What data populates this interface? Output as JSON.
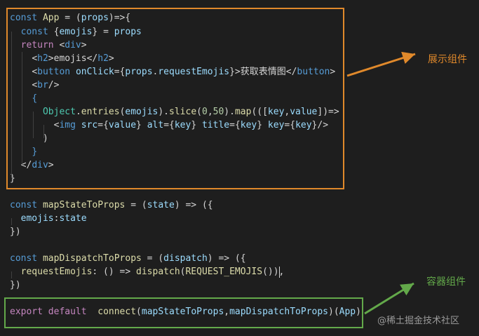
{
  "editor": {
    "lines": [
      [
        {
          "t": "const ",
          "c": "k1"
        },
        {
          "t": "App",
          "c": "fn"
        },
        {
          "t": " = (",
          "c": "punc"
        },
        {
          "t": "props",
          "c": "var"
        },
        {
          "t": ")=>{",
          "c": "punc"
        }
      ],
      [
        {
          "t": "  ",
          "c": "punc"
        },
        {
          "t": "const ",
          "c": "k1"
        },
        {
          "t": "{",
          "c": "punc"
        },
        {
          "t": "emojis",
          "c": "var"
        },
        {
          "t": "} = ",
          "c": "punc"
        },
        {
          "t": "props",
          "c": "var"
        }
      ],
      [
        {
          "t": "  ",
          "c": "punc"
        },
        {
          "t": "return ",
          "c": "k2"
        },
        {
          "t": "<",
          "c": "punc"
        },
        {
          "t": "div",
          "c": "tag"
        },
        {
          "t": ">",
          "c": "punc"
        }
      ],
      [
        {
          "t": "    ",
          "c": "punc"
        },
        {
          "t": "<",
          "c": "punc"
        },
        {
          "t": "h2",
          "c": "tag"
        },
        {
          "t": ">emojis</",
          "c": "punc"
        },
        {
          "t": "h2",
          "c": "tag"
        },
        {
          "t": ">",
          "c": "punc"
        }
      ],
      [
        {
          "t": "    ",
          "c": "punc"
        },
        {
          "t": "<",
          "c": "punc"
        },
        {
          "t": "button ",
          "c": "tag"
        },
        {
          "t": "onClick",
          "c": "attr"
        },
        {
          "t": "={",
          "c": "punc"
        },
        {
          "t": "props",
          "c": "var"
        },
        {
          "t": ".",
          "c": "punc"
        },
        {
          "t": "requestEmojis",
          "c": "var"
        },
        {
          "t": "}>获取表情图</",
          "c": "punc"
        },
        {
          "t": "button",
          "c": "tag"
        },
        {
          "t": ">",
          "c": "punc"
        }
      ],
      [
        {
          "t": "    ",
          "c": "punc"
        },
        {
          "t": "<",
          "c": "punc"
        },
        {
          "t": "br",
          "c": "tag"
        },
        {
          "t": "/>",
          "c": "punc"
        }
      ],
      [
        {
          "t": "    ",
          "c": "punc"
        },
        {
          "t": "{",
          "c": "k1"
        }
      ],
      [
        {
          "t": "      ",
          "c": "punc"
        },
        {
          "t": "Object",
          "c": "cls"
        },
        {
          "t": ".",
          "c": "punc"
        },
        {
          "t": "entries",
          "c": "fn"
        },
        {
          "t": "(",
          "c": "punc"
        },
        {
          "t": "emojis",
          "c": "var"
        },
        {
          "t": ").",
          "c": "punc"
        },
        {
          "t": "slice",
          "c": "fn"
        },
        {
          "t": "(",
          "c": "punc"
        },
        {
          "t": "0",
          "c": "num"
        },
        {
          "t": ",",
          "c": "punc"
        },
        {
          "t": "50",
          "c": "num"
        },
        {
          "t": ").",
          "c": "punc"
        },
        {
          "t": "map",
          "c": "fn"
        },
        {
          "t": "(([",
          "c": "punc"
        },
        {
          "t": "key",
          "c": "var"
        },
        {
          "t": ",",
          "c": "punc"
        },
        {
          "t": "value",
          "c": "var"
        },
        {
          "t": "])=>",
          "c": "punc"
        }
      ],
      [
        {
          "t": "        ",
          "c": "punc"
        },
        {
          "t": "<",
          "c": "punc"
        },
        {
          "t": "img ",
          "c": "tag"
        },
        {
          "t": "src",
          "c": "attr"
        },
        {
          "t": "={",
          "c": "punc"
        },
        {
          "t": "value",
          "c": "var"
        },
        {
          "t": "} ",
          "c": "punc"
        },
        {
          "t": "alt",
          "c": "attr"
        },
        {
          "t": "={",
          "c": "punc"
        },
        {
          "t": "key",
          "c": "var"
        },
        {
          "t": "} ",
          "c": "punc"
        },
        {
          "t": "title",
          "c": "attr"
        },
        {
          "t": "={",
          "c": "punc"
        },
        {
          "t": "key",
          "c": "var"
        },
        {
          "t": "} ",
          "c": "punc"
        },
        {
          "t": "key",
          "c": "attr"
        },
        {
          "t": "={",
          "c": "punc"
        },
        {
          "t": "key",
          "c": "var"
        },
        {
          "t": "}/>",
          "c": "punc"
        }
      ],
      [
        {
          "t": "      )",
          "c": "punc"
        }
      ],
      [
        {
          "t": "    ",
          "c": "punc"
        },
        {
          "t": "}",
          "c": "k1"
        }
      ],
      [
        {
          "t": "  </",
          "c": "punc"
        },
        {
          "t": "div",
          "c": "tag"
        },
        {
          "t": ">",
          "c": "punc"
        }
      ],
      [
        {
          "t": "}",
          "c": "punc"
        }
      ],
      [
        {
          "t": "",
          "c": "punc"
        }
      ],
      [
        {
          "t": "const ",
          "c": "k1"
        },
        {
          "t": "mapStateToProps",
          "c": "fn"
        },
        {
          "t": " = (",
          "c": "punc"
        },
        {
          "t": "state",
          "c": "var"
        },
        {
          "t": ") => ({",
          "c": "punc"
        }
      ],
      [
        {
          "t": "  ",
          "c": "punc"
        },
        {
          "t": "emojis",
          "c": "var"
        },
        {
          "t": ":",
          "c": "punc"
        },
        {
          "t": "state",
          "c": "var"
        }
      ],
      [
        {
          "t": "})",
          "c": "punc"
        }
      ],
      [
        {
          "t": "",
          "c": "punc"
        }
      ],
      [
        {
          "t": "const ",
          "c": "k1"
        },
        {
          "t": "mapDispatchToProps",
          "c": "fn"
        },
        {
          "t": " = (",
          "c": "punc"
        },
        {
          "t": "dispatch",
          "c": "var"
        },
        {
          "t": ") => ({",
          "c": "punc"
        }
      ],
      [
        {
          "t": "  ",
          "c": "punc"
        },
        {
          "t": "requestEmojis",
          "c": "fn"
        },
        {
          "t": ": () => ",
          "c": "punc"
        },
        {
          "t": "dispatch",
          "c": "fn"
        },
        {
          "t": "(",
          "c": "punc"
        },
        {
          "t": "REQUEST_EMOJIS",
          "c": "fn"
        },
        {
          "t": "()),",
          "c": "punc"
        }
      ],
      [
        {
          "t": "})",
          "c": "punc"
        }
      ],
      [
        {
          "t": "",
          "c": "punc"
        }
      ],
      [
        {
          "t": "export ",
          "c": "k2"
        },
        {
          "t": "default ",
          "c": "k2"
        },
        {
          "t": " ",
          "c": "punc"
        },
        {
          "t": "connect",
          "c": "fn"
        },
        {
          "t": "(",
          "c": "punc"
        },
        {
          "t": "mapStateToProps",
          "c": "var"
        },
        {
          "t": ",",
          "c": "punc"
        },
        {
          "t": "mapDispatchToProps",
          "c": "var"
        },
        {
          "t": ")(",
          "c": "punc"
        },
        {
          "t": "App",
          "c": "var"
        },
        {
          "t": ")",
          "c": "punc"
        }
      ]
    ]
  },
  "annotations": {
    "presentational_label": "展示组件",
    "container_label": "容器组件",
    "orange_color": "#e0892b",
    "green_color": "#63a94a"
  },
  "watermark": "@稀土掘金技术社区"
}
